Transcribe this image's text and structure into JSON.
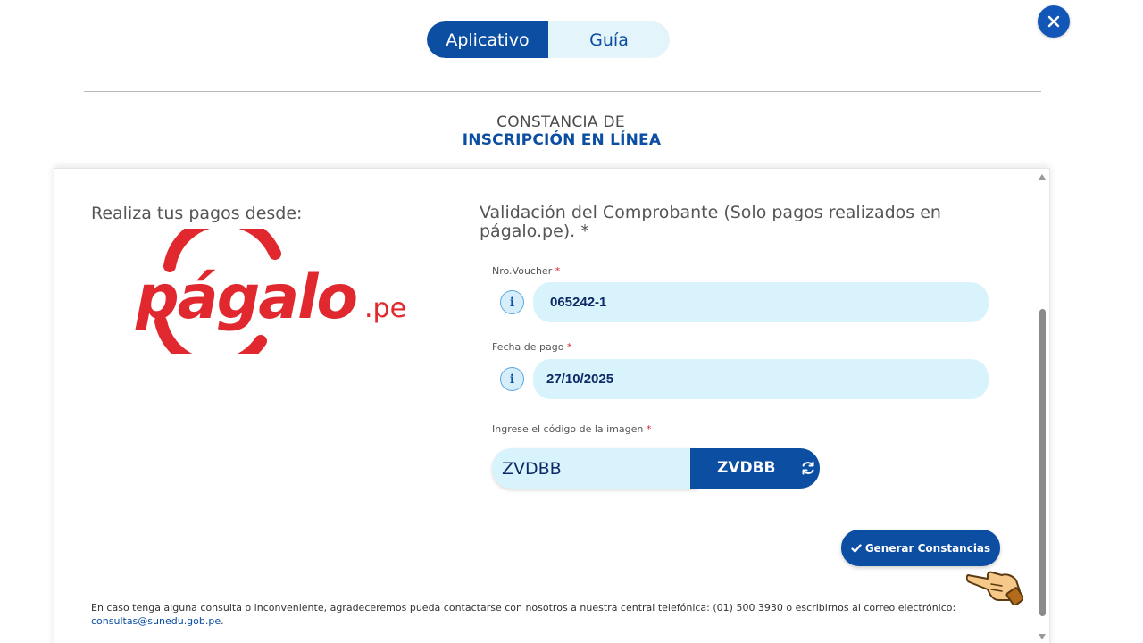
{
  "tabs": [
    {
      "label": "Aplicativo",
      "active": true
    },
    {
      "label": "Guía",
      "active": false
    }
  ],
  "header": {
    "title_line1": "CONSTANCIA DE",
    "title_line2": "INSCRIPCIÓN EN LÍNEA"
  },
  "left": {
    "heading": "Realiza tus pagos desde:",
    "logo_text": "págalo",
    "logo_suffix": ".pe"
  },
  "form": {
    "heading": "Validación del Comprobante (Solo pagos realizados en págalo.pe). *",
    "voucher": {
      "label": "Nro.Voucher",
      "required_mark": "*",
      "value": "065242-1"
    },
    "fecha": {
      "label": "Fecha de pago",
      "required_mark": "*",
      "value": "27/10/2025"
    },
    "captcha": {
      "label": "Ingrese el código de la imagen",
      "required_mark": "*",
      "input_value": "ZVDBB",
      "image_code": "ZVDBB"
    },
    "info_icon_glyph": "i",
    "submit_label": "Generar Constancias"
  },
  "footer": {
    "text": "En caso tenga alguna consulta o inconveniente, agradeceremos pueda contactarse con nosotros a nuestra central telefónica: (01) 500 3930 o escribirnos al correo electrónico:",
    "email": "consultas@sunedu.gob.pe",
    "email_suffix": "."
  },
  "colors": {
    "primary": "#0b4ea2",
    "input_bg": "#d8f3fc",
    "logo_red": "#e0282e",
    "required": "#d9262c"
  },
  "icons": [
    "close-icon",
    "info-icon",
    "refresh-icon",
    "check-icon",
    "pointing-hand-icon",
    "scroll-up-arrow",
    "scroll-down-arrow"
  ]
}
